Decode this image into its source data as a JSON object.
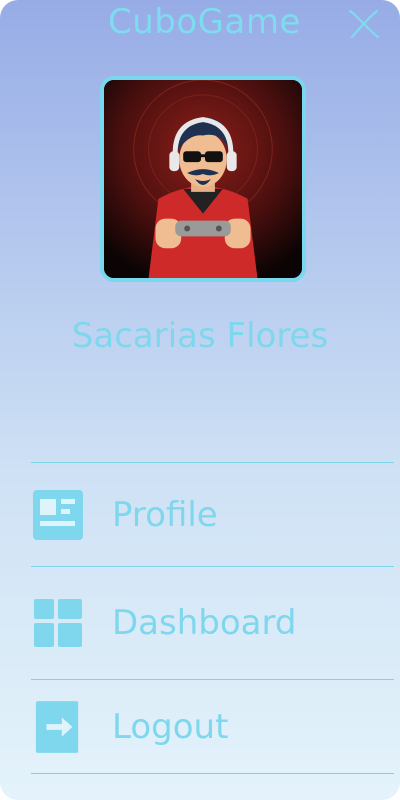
{
  "app": {
    "title": "CuboGame"
  },
  "header": {
    "close_icon": "close-icon"
  },
  "user": {
    "name": "Sacarias Flores",
    "avatar": "gamer-avatar"
  },
  "menu": {
    "items": [
      {
        "label": "Profile",
        "icon": "profile-card-icon"
      },
      {
        "label": "Dashboard",
        "icon": "dashboard-icon"
      },
      {
        "label": "Logout",
        "icon": "logout-icon"
      }
    ]
  },
  "colors": {
    "accent": "#7fd7ee",
    "gradient_top": "#97ace6",
    "gradient_bottom": "#e4f3fb"
  }
}
